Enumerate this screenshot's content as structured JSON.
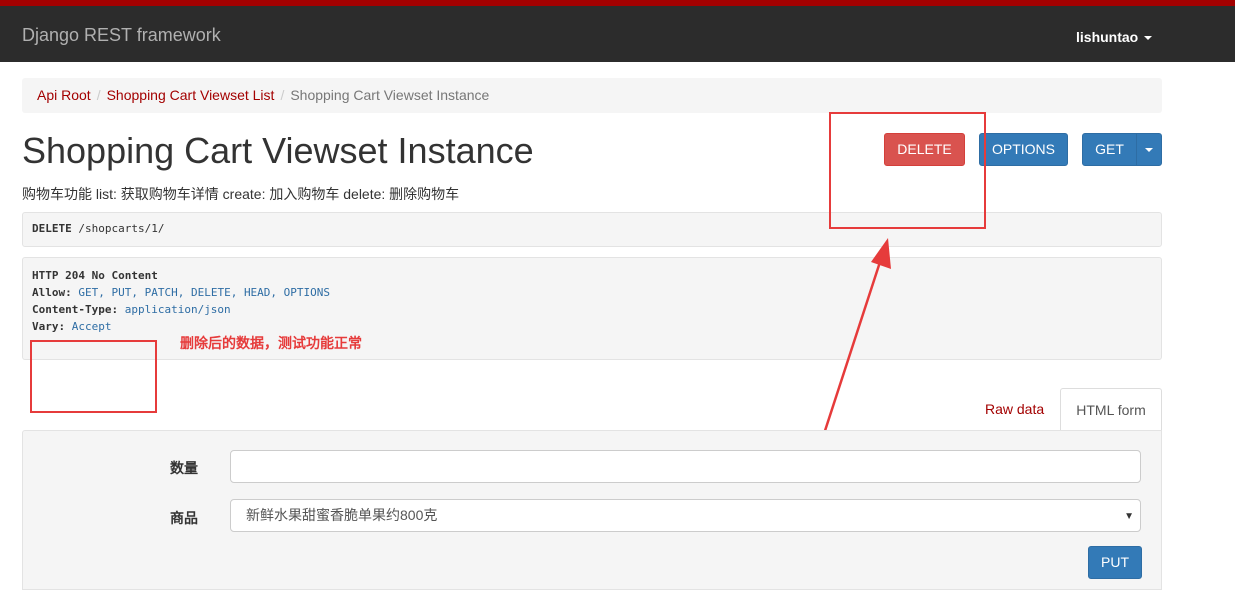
{
  "navbar": {
    "brand": "Django REST framework",
    "user": "lishuntao"
  },
  "breadcrumb": [
    {
      "label": "Api Root"
    },
    {
      "label": "Shopping Cart Viewset List"
    },
    {
      "label": "Shopping Cart Viewset Instance"
    }
  ],
  "page": {
    "title": "Shopping Cart Viewset Instance",
    "description": "购物车功能 list: 获取购物车详情 create: 加入购物车 delete: 删除购物车"
  },
  "buttons": {
    "delete": "DELETE",
    "options": "OPTIONS",
    "get": "GET",
    "put": "PUT"
  },
  "request": {
    "method": "DELETE",
    "path": "/shopcarts/1/"
  },
  "response": {
    "status": "HTTP 204 No Content",
    "allow_key": "Allow:",
    "allow_value": "GET, PUT, PATCH, DELETE, HEAD, OPTIONS",
    "content_type_key": "Content-Type:",
    "content_type_value": "application/json",
    "vary_key": "Vary:",
    "vary_value": "Accept"
  },
  "annotation": {
    "text": "删除后的数据，测试功能正常",
    "color": "#e63b3b"
  },
  "tabs": {
    "raw": "Raw data",
    "html": "HTML form"
  },
  "form": {
    "qty_label": "数量",
    "qty_value": "",
    "goods_label": "商品",
    "goods_selected": "新鲜水果甜蜜香脆单果约800克"
  },
  "colors": {
    "brand_red": "#a30000",
    "danger": "#d9534f",
    "primary": "#337ab7"
  }
}
